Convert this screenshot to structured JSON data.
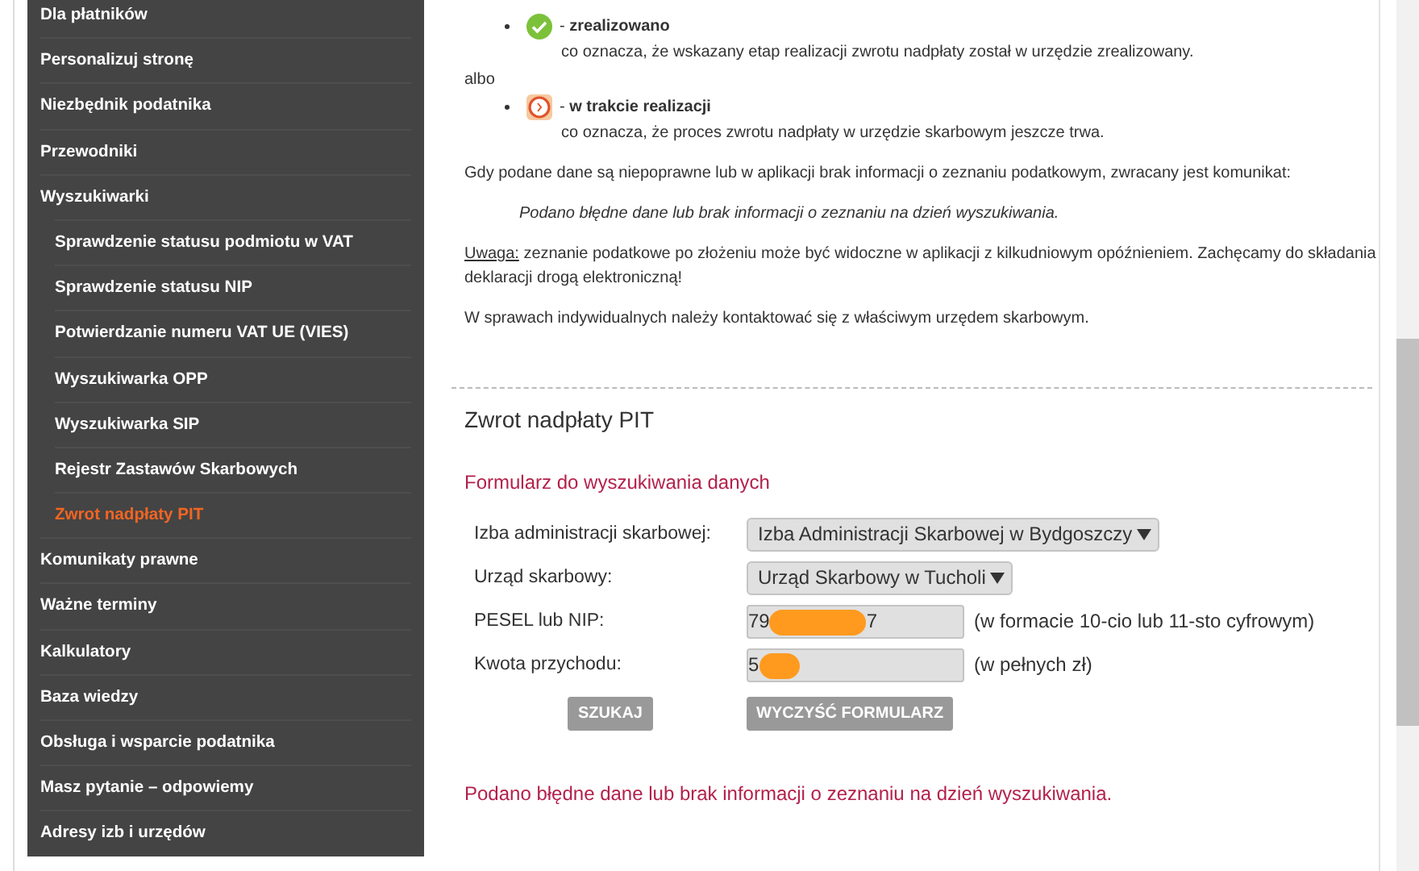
{
  "sidebar": {
    "items": [
      {
        "label": "Dla płatników",
        "selected": false
      },
      {
        "label": "Personalizuj stronę",
        "selected": false
      },
      {
        "label": "Niezbędnik podatnika",
        "selected": false
      },
      {
        "label": "Przewodniki",
        "selected": false
      },
      {
        "label": "Wyszukiwarki",
        "selected": false,
        "children": [
          {
            "label": "Sprawdzenie statusu podmiotu w VAT",
            "selected": false
          },
          {
            "label": "Sprawdzenie statusu NIP",
            "selected": false
          },
          {
            "label": "Potwierdzanie numeru VAT UE (VIES)",
            "selected": false
          },
          {
            "label": "Wyszukiwarka OPP",
            "selected": false
          },
          {
            "label": "Wyszukiwarka SIP",
            "selected": false
          },
          {
            "label": "Rejestr Zastawów Skarbowych",
            "selected": false
          },
          {
            "label": "Zwrot nadpłaty PIT",
            "selected": true
          }
        ]
      },
      {
        "label": "Komunikaty prawne",
        "selected": false
      },
      {
        "label": "Ważne terminy",
        "selected": false
      },
      {
        "label": "Kalkulatory",
        "selected": false
      },
      {
        "label": "Baza wiedzy",
        "selected": false
      },
      {
        "label": "Obsługa i wsparcie podatnika",
        "selected": false
      },
      {
        "label": "Masz pytanie – odpowiemy",
        "selected": false
      },
      {
        "label": "Adresy izb i urzędów",
        "selected": false
      }
    ]
  },
  "legend": [
    {
      "kind": "done",
      "label": "- **zrealizowano**",
      "description": "co oznacza, że wskazany etap realizacji zwrotu nadpłaty został w urzędzie zrealizowany."
    },
    {
      "kind": "separator",
      "label": "albo"
    },
    {
      "kind": "pending",
      "label": "- **w trakcie realizacji**",
      "description": "co oznacza, że proces zwrotu nadpłaty w urzędzie skarbowym jeszcze trwa."
    }
  ],
  "intro": "Gdy podane dane są niepoprawne lub w aplikacji brak informacji o zeznaniu podatkowym, zwracany jest komunikat:",
  "quote": "Podano błędne dane lub brak informacji o zeznaniu na dzień wyszukiwania.",
  "note": {
    "label": "Uwaga:",
    "text": "zeznanie podatkowe po złożeniu może być widoczne w aplikacji z kilkudniowym opóźnieniem. Zachęcamy do składania deklaracji drogą elektroniczną!"
  },
  "closing": "W sprawach indywidualnych należy kontaktować się z właściwym urzędem skarbowym.",
  "form": {
    "title": "Zwrot nadpłaty PIT",
    "subtitle": "Formularz do wyszukiwania danych",
    "fields": [
      {
        "kind": "select",
        "label": "Izba administracji skarbowej:",
        "value": "Izba Administracji Skarbowej w Bydgoszczy"
      },
      {
        "kind": "select",
        "label": "Urząd skarbowy:",
        "value": "Urząd Skarbowy w Tucholi"
      },
      {
        "kind": "input",
        "label": "PESEL lub NIP:",
        "value_start": "79",
        "value_end": "7",
        "redacted": true,
        "hint": "(w formacie 10-cio lub 11-sto cyfrowym)"
      },
      {
        "kind": "input",
        "label": "Kwota przychodu:",
        "value_start": "5",
        "redacted": true,
        "hint": "(w pełnych zł)"
      }
    ],
    "buttons": [
      "SZUKAJ",
      "WYCZYŚĆ FORMULARZ"
    ],
    "error": "Podano błędne dane lub brak informacji o zeznaniu na dzień wyszukiwania."
  }
}
